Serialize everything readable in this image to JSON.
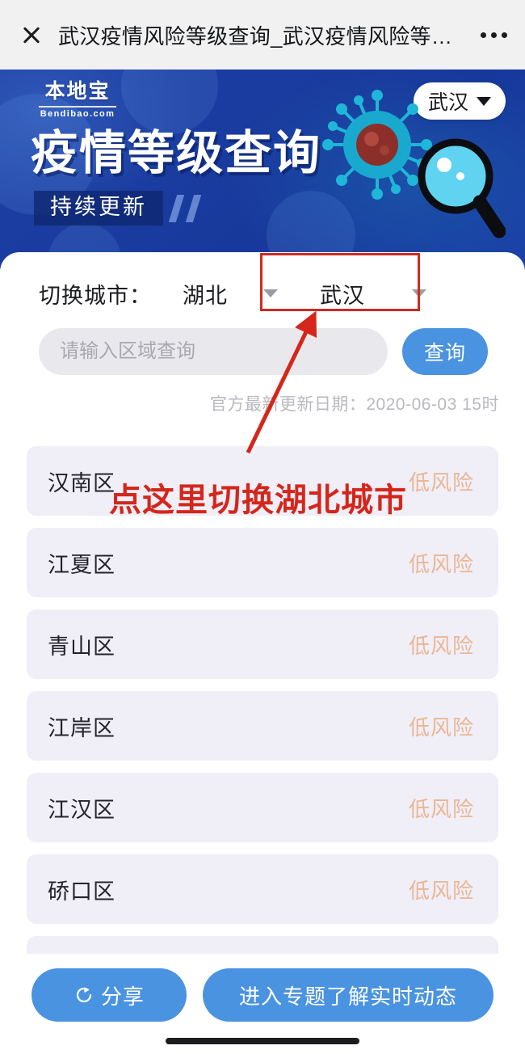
{
  "topbar": {
    "close_icon": "close-icon",
    "title": "武汉疫情风险等级查询_武汉疫情风险等…",
    "more_icon": "more-dots-icon"
  },
  "banner": {
    "logo_main": "本地宝",
    "logo_sub": "Bendibao.com",
    "city_pill": "武汉",
    "hero_title": "疫情等级查询",
    "hero_subtitle": "持续更新",
    "virus_icon": "virus-icon",
    "magnifier_icon": "magnifier-icon",
    "bg_color": "#1a3ca0"
  },
  "switch": {
    "label": "切换城市：",
    "province": "湖北",
    "city": "武汉"
  },
  "search": {
    "placeholder": "请输入区域查询",
    "value": "",
    "button_label": "查询"
  },
  "update": {
    "text": "官方最新更新日期：2020-06-03 15时"
  },
  "districts": [
    {
      "name": "汉南区",
      "risk": "低风险"
    },
    {
      "name": "江夏区",
      "risk": "低风险"
    },
    {
      "name": "青山区",
      "risk": "低风险"
    },
    {
      "name": "江岸区",
      "risk": "低风险"
    },
    {
      "name": "江汉区",
      "risk": "低风险"
    },
    {
      "name": "硚口区",
      "risk": "低风险"
    },
    {
      "name": "",
      "risk": ""
    }
  ],
  "risk_color": "#eab795",
  "bottom": {
    "share_label": "分享",
    "share_icon": "share-icon",
    "topic_label": "进入专题了解实时动态",
    "accent_color": "#4a93e0"
  },
  "annotation": {
    "text": "点这里切换湖北城市",
    "color": "#d4271c",
    "box_target": "city-select"
  }
}
